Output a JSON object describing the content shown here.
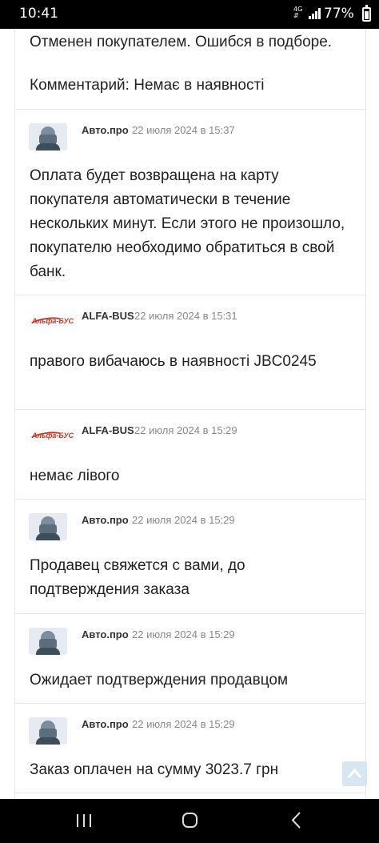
{
  "status_bar": {
    "time": "10:41",
    "network": "4G",
    "network_arrows": "⇵",
    "battery_percent": "77%"
  },
  "top_block": {
    "line1": "Отменен покупателем. Ошибся в подборе.",
    "line2": "Комментарий: Немає в наявності"
  },
  "messages": [
    {
      "author": "Авто.про",
      "avatar": "robot-avatar",
      "date": "22 июля 2024 в 15:37",
      "text": "Оплата будет возвращена на карту покупателя автоматически в течение нескольких минут. Если этого не произошло, покупателю необходимо обратиться в свой банк."
    },
    {
      "author": "ALFA-BUS",
      "avatar": "alfa-bus-logo",
      "logo_text": "Альфа-БУС",
      "date": "22 июля 2024 в 15:31",
      "text": "правого вибачаюсь в наявності JBC0245"
    },
    {
      "author": "ALFA-BUS",
      "avatar": "alfa-bus-logo",
      "logo_text": "Альфа-БУС",
      "date": "22 июля 2024 в 15:29",
      "text": "немає лівого"
    },
    {
      "author": "Авто.про",
      "avatar": "robot-avatar",
      "date": "22 июля 2024 в 15:29",
      "text": "Продавец свяжется с вами, до подтверждения заказа"
    },
    {
      "author": "Авто.про",
      "avatar": "robot-avatar",
      "date": "22 июля 2024 в 15:29",
      "text": "Ожидает подтверждения продавцом"
    },
    {
      "author": "Авто.про",
      "avatar": "robot-avatar",
      "date": "22 июля 2024 в 15:29",
      "text": "Заказ оплачен на сумму 3023.7 грн"
    }
  ],
  "colors": {
    "brand_red": "#c0392b",
    "scroll_button": "#d8e6f2",
    "divider": "#e6e6e6"
  },
  "icons": {
    "scroll_top": "chevron-up-icon",
    "nav_recents": "recents-icon",
    "nav_home": "home-icon",
    "nav_back": "back-icon"
  }
}
